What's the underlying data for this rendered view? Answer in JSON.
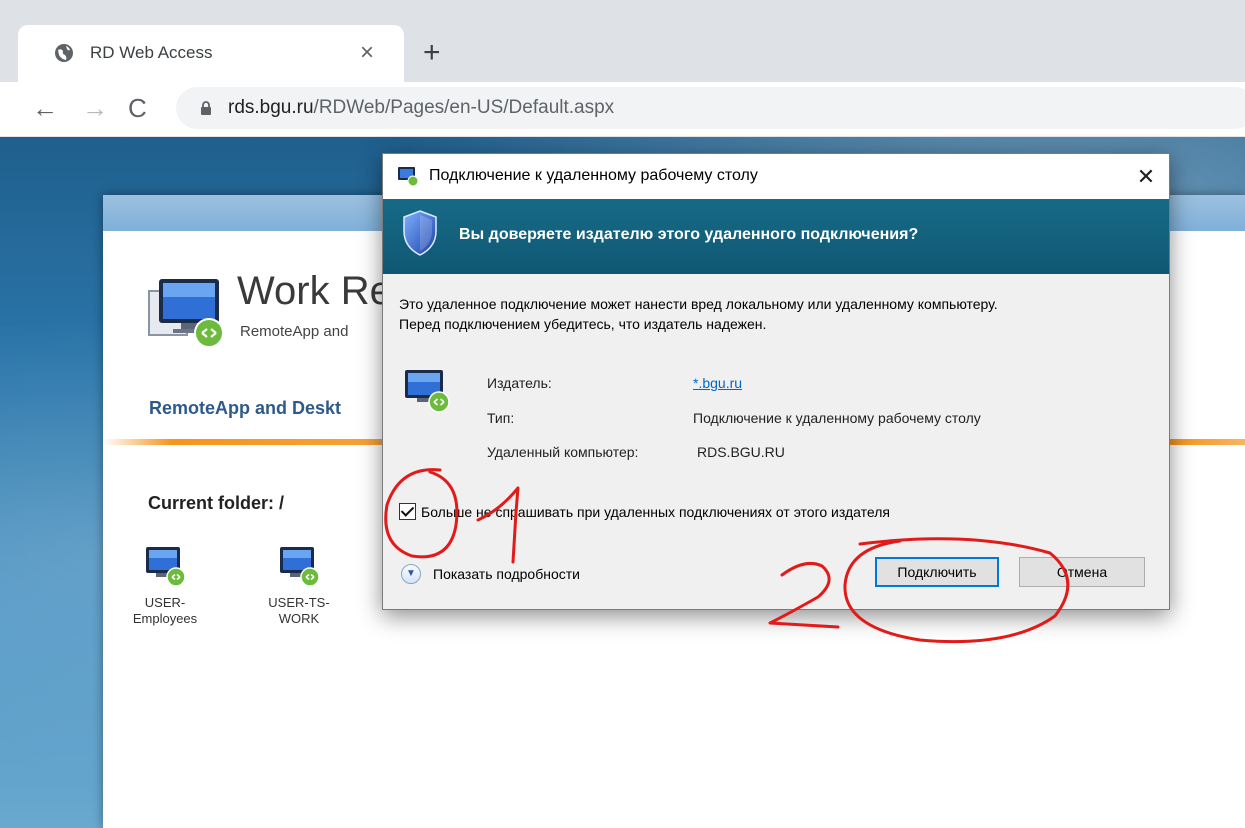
{
  "browser": {
    "tab_title": "RD Web Access",
    "tab_close": "×",
    "new_tab": "+",
    "url_host": "rds.bgu.ru",
    "url_path": "/RDWeb/Pages/en-US/Default.aspx",
    "back": "←",
    "forward": "→",
    "reload": "C"
  },
  "rdweb": {
    "title": "Work Re",
    "subtitle": "RemoteApp and",
    "tab": "RemoteApp and Deskt",
    "current_folder": "Current folder: /",
    "apps": [
      {
        "label_line1": "USER-",
        "label_line2": "Employees"
      },
      {
        "label_line1": "USER-TS-",
        "label_line2": "WORK"
      }
    ]
  },
  "dialog": {
    "title": "Подключение к удаленному рабочему столу",
    "close": "✕",
    "question": "Вы доверяете издателю этого удаленного подключения?",
    "warning_line1": "Это удаленное подключение может нанести вред локальному или удаленному компьютеру.",
    "warning_line2": "Перед подключением убедитесь, что издатель надежен.",
    "publisher_label": "Издатель:",
    "publisher_value": "*.bgu.ru",
    "type_label": "Тип:",
    "type_value": "Подключение к удаленному рабочему столу",
    "remote_label": "Удаленный компьютер:",
    "remote_value": "RDS.BGU.RU",
    "checkbox_label": "Больше не спрашивать при удаленных подключениях от этого издателя",
    "checkbox_checked": true,
    "details": "Показать подробности",
    "details_chevron": "▼",
    "connect_button": "Подключить",
    "cancel_button": "Отмена"
  },
  "annotations": {
    "color": "#e11a1a",
    "marks": [
      "1",
      "2"
    ]
  }
}
